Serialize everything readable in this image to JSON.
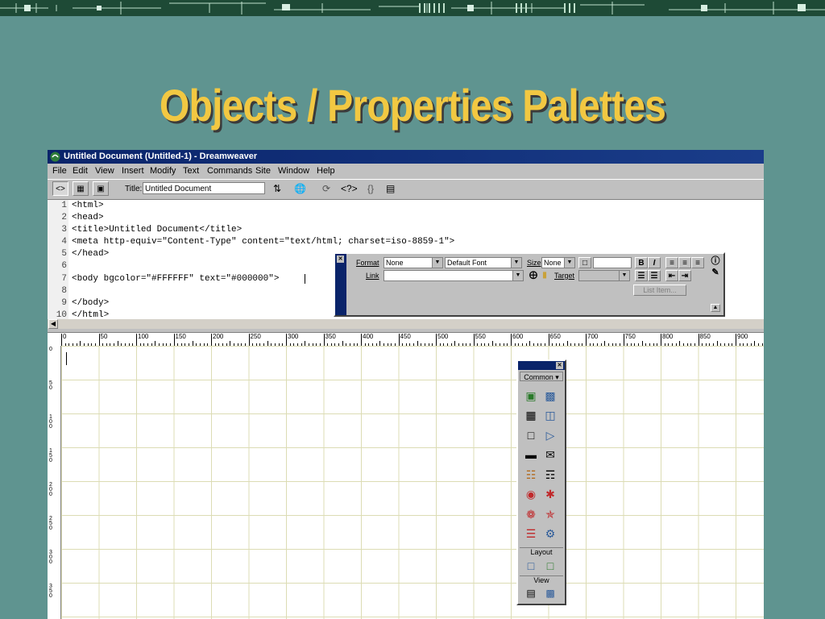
{
  "slide_title": "Objects / Properties Palettes",
  "window": {
    "title": "Untitled Document (Untitled-1) - Dreamweaver"
  },
  "menu": [
    "File",
    "Edit",
    "View",
    "Insert",
    "Modify",
    "Text",
    "Commands",
    "Site",
    "Window",
    "Help"
  ],
  "toolbar": {
    "title_label": "Title:",
    "title_value": "Untitled Document"
  },
  "code_lines": [
    {
      "num": "1",
      "text": "<html>"
    },
    {
      "num": "2",
      "text": "<head>"
    },
    {
      "num": "3",
      "text": "<title>Untitled Document</title>"
    },
    {
      "num": "4",
      "text": "<meta http-equiv=\"Content-Type\" content=\"text/html; charset=iso-8859-1\">"
    },
    {
      "num": "5",
      "text": "</head>"
    },
    {
      "num": "6",
      "text": ""
    },
    {
      "num": "7",
      "text": "<body bgcolor=\"#FFFFFF\" text=\"#000000\">"
    },
    {
      "num": "8",
      "text": ""
    },
    {
      "num": "9",
      "text": "</body>"
    },
    {
      "num": "10",
      "text": "</html>"
    }
  ],
  "ruler_top": [
    "0",
    "50",
    "100",
    "150",
    "200",
    "250",
    "300",
    "350",
    "400",
    "450",
    "500",
    "550",
    "600",
    "650",
    "700",
    "750",
    "800",
    "850",
    "900"
  ],
  "ruler_left": [
    "0",
    "50",
    "100",
    "150",
    "200",
    "250",
    "300",
    "350"
  ],
  "properties": {
    "format_label": "Format",
    "format_value": "None",
    "font_value": "Default Font",
    "size_label": "Size",
    "size_value": "None",
    "link_label": "Link",
    "target_label": "Target",
    "bold": "B",
    "italic": "I",
    "list_item": "List Item..."
  },
  "objects_panel": {
    "category": "Common",
    "section_layout": "Layout",
    "section_view": "View"
  },
  "colors": {
    "slide_bg": "#5f9490",
    "title_color": "#f2c842",
    "titlebar": "#0a246a"
  }
}
